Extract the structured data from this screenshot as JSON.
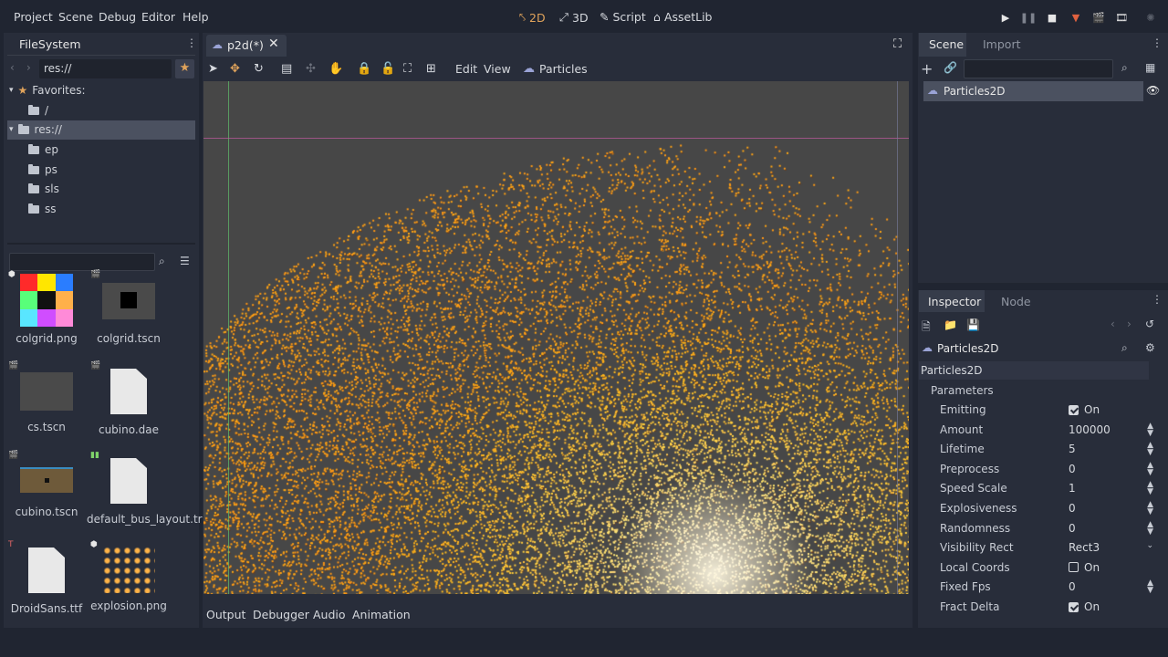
{
  "menu": [
    "Project",
    "Scene",
    "Debug",
    "Editor",
    "Help"
  ],
  "workspaces": [
    {
      "icon": "2d-icon",
      "label": "2D",
      "active": true
    },
    {
      "icon": "3d-icon",
      "label": "3D",
      "active": false
    },
    {
      "icon": "script-icon",
      "label": "Script",
      "active": false
    },
    {
      "icon": "assetlib-icon",
      "label": "AssetLib",
      "active": false
    }
  ],
  "filesystem": {
    "tab": "FileSystem",
    "path": "res://",
    "favorites_label": "Favorites:",
    "tree": [
      "/",
      "res://",
      "ep",
      "ps",
      "sls",
      "ss"
    ],
    "search_placeholder": "",
    "files": [
      {
        "name": "colgrid.png",
        "kind": "colgrid"
      },
      {
        "name": "colgrid.tscn",
        "kind": "scene-dark"
      },
      {
        "name": "cs.tscn",
        "kind": "scene-grey"
      },
      {
        "name": "cubino.dae",
        "kind": "doc"
      },
      {
        "name": "cubino.tscn",
        "kind": "scene-brown"
      },
      {
        "name": "default_bus_layout.tres",
        "kind": "doc"
      },
      {
        "name": "DroidSans.ttf",
        "kind": "doc"
      },
      {
        "name": "explosion.png",
        "kind": "explosion"
      }
    ]
  },
  "editor": {
    "tab_title": "p2d(*)",
    "toolbar_menus": [
      "Edit",
      "View"
    ],
    "particles_menu": "Particles",
    "bottom_tabs": [
      "Output",
      "Debugger",
      "Audio",
      "Animation"
    ]
  },
  "scene": {
    "tabs": [
      "Scene",
      "Import"
    ],
    "filter_placeholder": "",
    "root_node": "Particles2D"
  },
  "inspector": {
    "tabs": [
      "Inspector",
      "Node"
    ],
    "object": "Particles2D",
    "class_header": "Particles2D",
    "section": "Parameters",
    "properties": [
      {
        "name": "Emitting",
        "value": "On",
        "type": "check",
        "checked": true
      },
      {
        "name": "Amount",
        "value": "100000",
        "type": "spin"
      },
      {
        "name": "Lifetime",
        "value": "5",
        "type": "spin"
      },
      {
        "name": "Preprocess",
        "value": "0",
        "type": "spin"
      },
      {
        "name": "Speed Scale",
        "value": "1",
        "type": "spin"
      },
      {
        "name": "Explosiveness",
        "value": "0",
        "type": "spin"
      },
      {
        "name": "Randomness",
        "value": "0",
        "type": "spin"
      },
      {
        "name": "Visibility Rect",
        "value": "Rect3",
        "type": "dropdown"
      },
      {
        "name": "Local Coords",
        "value": "On",
        "type": "check",
        "checked": false
      },
      {
        "name": "Fixed Fps",
        "value": "0",
        "type": "spin"
      },
      {
        "name": "Fract Delta",
        "value": "On",
        "type": "check",
        "checked": true
      }
    ]
  },
  "colors": {
    "accent": "#e0a35b",
    "panel": "#282d3a",
    "bg": "#202531",
    "selection": "#4b5160"
  }
}
